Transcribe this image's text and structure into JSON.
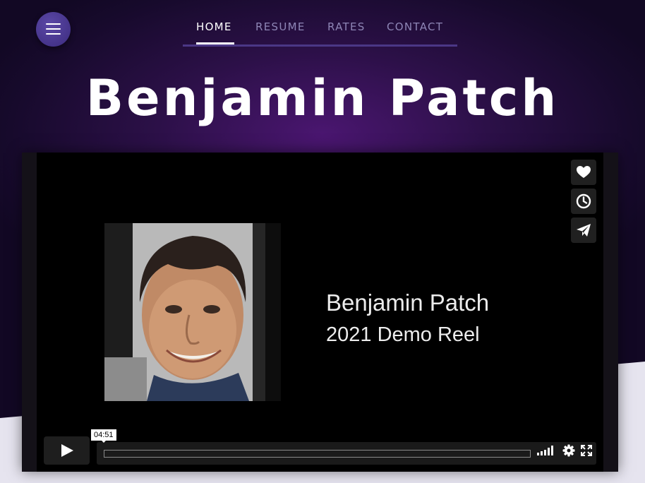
{
  "nav": {
    "menu_icon": "hamburger-icon",
    "links": [
      "HOME",
      "RESUME",
      "RATES",
      "CONTACT"
    ],
    "active": "HOME"
  },
  "hero": {
    "title": "Benjamin Patch"
  },
  "video": {
    "slate_title": "Benjamin Patch",
    "slate_subtitle": "2021 Demo Reel",
    "duration": "04:51",
    "progress": 0,
    "side_actions": [
      "heart-icon",
      "clock-icon",
      "paper-plane-icon"
    ],
    "controls": [
      "play-icon",
      "volume-icon",
      "gear-icon",
      "fullscreen-icon"
    ]
  },
  "colors": {
    "background_dark": "#170a2c",
    "background_glow": "#4a1670",
    "accent": "#4b3786",
    "menu_button": "#4a3a94",
    "lower_panel": "#e6e4ef"
  }
}
